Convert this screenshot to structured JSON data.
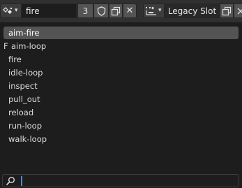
{
  "header": {
    "datablock_name": "fire",
    "users_count": "3",
    "slot_label": "Legacy Slot"
  },
  "actions": [
    {
      "label": "aim-fire",
      "selected": true,
      "prefix": ""
    },
    {
      "label": "aim-loop",
      "selected": false,
      "prefix": "F"
    },
    {
      "label": "fire",
      "selected": false,
      "prefix": ""
    },
    {
      "label": "idle-loop",
      "selected": false,
      "prefix": ""
    },
    {
      "label": "inspect",
      "selected": false,
      "prefix": ""
    },
    {
      "label": "pull_out",
      "selected": false,
      "prefix": ""
    },
    {
      "label": "reload",
      "selected": false,
      "prefix": ""
    },
    {
      "label": "run-loop",
      "selected": false,
      "prefix": ""
    },
    {
      "label": "walk-loop",
      "selected": false,
      "prefix": ""
    }
  ],
  "search": {
    "value": "",
    "placeholder": ""
  },
  "colors": {
    "selected_row": "#545454",
    "caret": "#4d8bd1",
    "background": "#1d1d1d"
  }
}
